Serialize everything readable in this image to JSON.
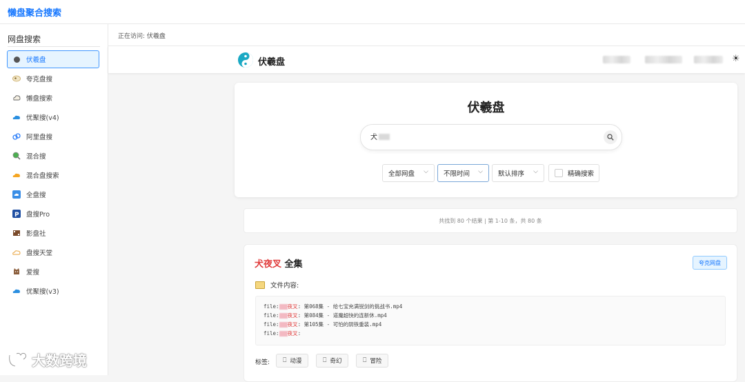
{
  "app": {
    "title": "懒盘聚合搜索"
  },
  "sidebar": {
    "heading": "网盘搜索",
    "items": [
      {
        "label": "伏羲盘",
        "icon": "dot-icon",
        "active": true
      },
      {
        "label": "夸克盘搜",
        "icon": "quark-icon"
      },
      {
        "label": "懒盘搜索",
        "icon": "cloud-outline-icon"
      },
      {
        "label": "优聚搜(v4)",
        "icon": "blue-cloud-icon"
      },
      {
        "label": "阿里盘搜",
        "icon": "aliyun-icon"
      },
      {
        "label": "混合搜",
        "icon": "magnifier-globe-icon"
      },
      {
        "label": "混合盘搜索",
        "icon": "orange-cloud-icon"
      },
      {
        "label": "全盘搜",
        "icon": "blue-square-cloud-icon"
      },
      {
        "label": "盘搜Pro",
        "icon": "p-badge-icon"
      },
      {
        "label": "影盘社",
        "icon": "film-icon"
      },
      {
        "label": "盘搜天堂",
        "icon": "cloud-outline-orange-icon"
      },
      {
        "label": "爱搜",
        "icon": "cat-icon"
      },
      {
        "label": "优聚搜(v3)",
        "icon": "blue-cloud-icon"
      }
    ]
  },
  "breadcrumb": {
    "text": "正在访问: 伏羲盘"
  },
  "site": {
    "name": "伏羲盘"
  },
  "hero": {
    "title": "伏羲盘",
    "search_value": "犬",
    "filters": {
      "disk": "全部网盘",
      "time": "不限时间",
      "sort": "默认排序",
      "exact": "精确搜索"
    }
  },
  "results": {
    "summary": "共找到 80 个结果 | 第 1-10 条，共 80 条",
    "first": {
      "title_highlight": "犬夜叉",
      "title_rest": " 全集",
      "source": "夸克网盘",
      "files_heading": "文件内容:",
      "files": [
        {
          "prefix": "file:",
          "hl": "夜叉",
          "text": ": 第068集 - 给七宝充满锐剑的挑战书.mp4"
        },
        {
          "prefix": "file:",
          "hl": "夜叉",
          "text": ": 第084集 - 道魔超快的连新休.mp4"
        },
        {
          "prefix": "file:",
          "hl": "夜叉",
          "text": ": 第105集 - 可怕的阴铁重装.mp4"
        },
        {
          "prefix": "file:",
          "hl": "夜叉",
          "text": ":"
        }
      ],
      "tags_label": "标签:",
      "tags": [
        "动漫",
        "奇幻",
        "冒险"
      ]
    }
  },
  "watermark": "大数跨境",
  "colors": {
    "accent": "#1677ff",
    "highlight": "#e03b3b"
  }
}
